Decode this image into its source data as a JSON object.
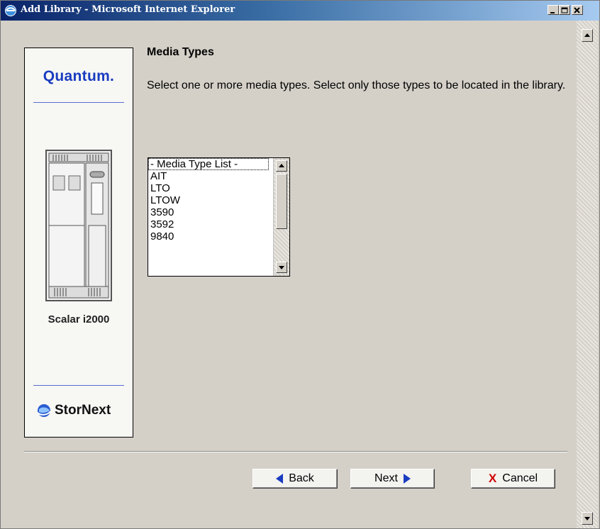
{
  "window": {
    "title": "Add Library - Microsoft Internet Explorer"
  },
  "brand": {
    "logo": "Quantum.",
    "product": "Scalar i2000",
    "suite": "StorNext"
  },
  "page": {
    "heading": "Media Types",
    "instructions": "Select one or more media types. Select only those types to be located in the library."
  },
  "media_list": {
    "items": [
      "- Media Type List -",
      "AIT",
      "LTO",
      "LTOW",
      "3590",
      "3592",
      "9840"
    ]
  },
  "buttons": {
    "back": "Back",
    "next": "Next",
    "cancel": "Cancel"
  },
  "colors": {
    "accent": "#1a3cc0",
    "cancel_x": "#d00000",
    "titlebar": "#0a246a"
  }
}
